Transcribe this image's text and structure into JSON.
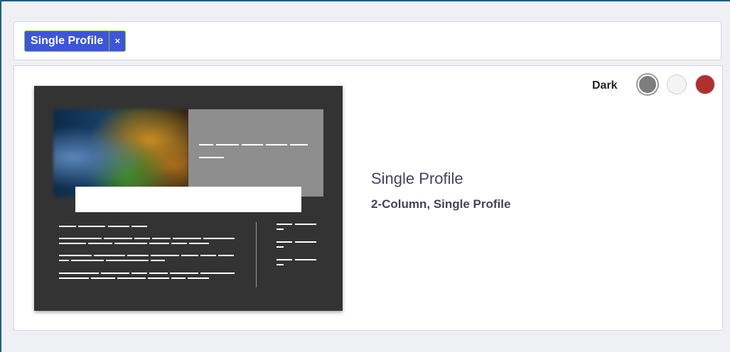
{
  "filter": {
    "tag_label": "Single Profile",
    "tag_remove": "×"
  },
  "card": {
    "title": "Single Profile",
    "subtitle": "2-Column, Single Profile",
    "theme_label": "Dark",
    "swatches": [
      {
        "name": "grey",
        "color": "#7d7d7d",
        "selected": true
      },
      {
        "name": "white",
        "color": "#f4f4f4",
        "selected": false
      },
      {
        "name": "red",
        "color": "#b03030",
        "selected": false
      }
    ]
  },
  "colors": {
    "accent": "#3d55d8",
    "tag_border": "#8fbf3a",
    "title_text": "#4a3f5c",
    "frame_border": "#1f5c86"
  }
}
